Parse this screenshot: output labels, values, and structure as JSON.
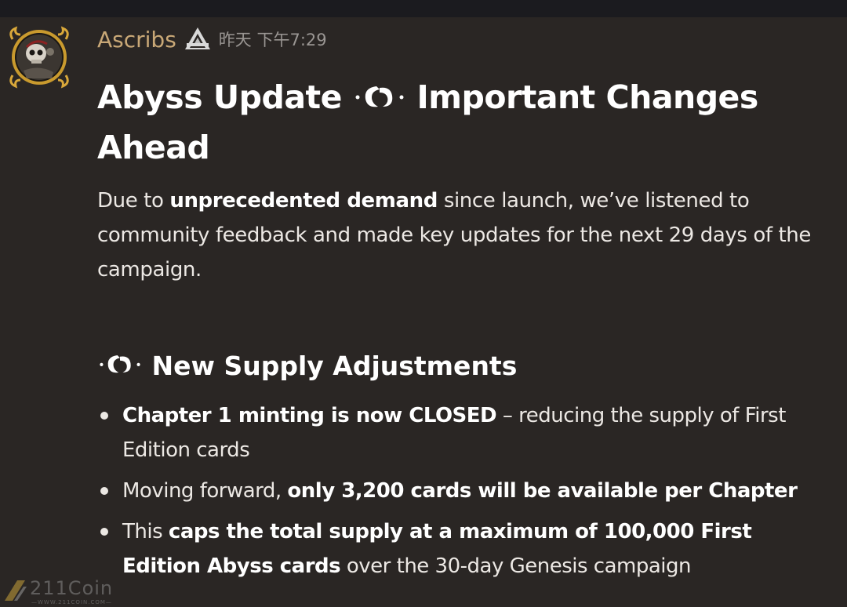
{
  "message": {
    "author": "Ascribs",
    "timestamp": "昨天 下午7:29",
    "title_part1": "Abyss Update",
    "title_part2": "Important Changes Ahead",
    "intro": {
      "before": "Due to ",
      "bold": "unprecedented demand",
      "after": " since launch, we’ve listened to community feedback and made key updates for the next 29 days of the campaign."
    },
    "section_heading": "New Supply Adjustments",
    "bullets": [
      {
        "bold": "Chapter 1 minting is now CLOSED",
        "after": " – reducing the supply of First Edition cards"
      },
      {
        "before": "Moving forward, ",
        "bold": "only 3,200 cards will be available per Chapter"
      },
      {
        "before": "This ",
        "bold": "caps the total supply at a maximum of 100,000 First Edition Abyss cards",
        "after": " over the 30-day Genesis campaign"
      }
    ]
  },
  "icons": {
    "avatar": "skull-avatar-icon",
    "app_badge": "mountain-tag-icon",
    "ornament": "abyss-swirl-icon"
  },
  "colors": {
    "background": "#2a2624",
    "author": "#c9a877",
    "timestamp": "#9a9693",
    "text": "#ece8e4"
  },
  "watermark": {
    "text": "211Coin",
    "sub": "—WWW.211COIN.COM—"
  }
}
